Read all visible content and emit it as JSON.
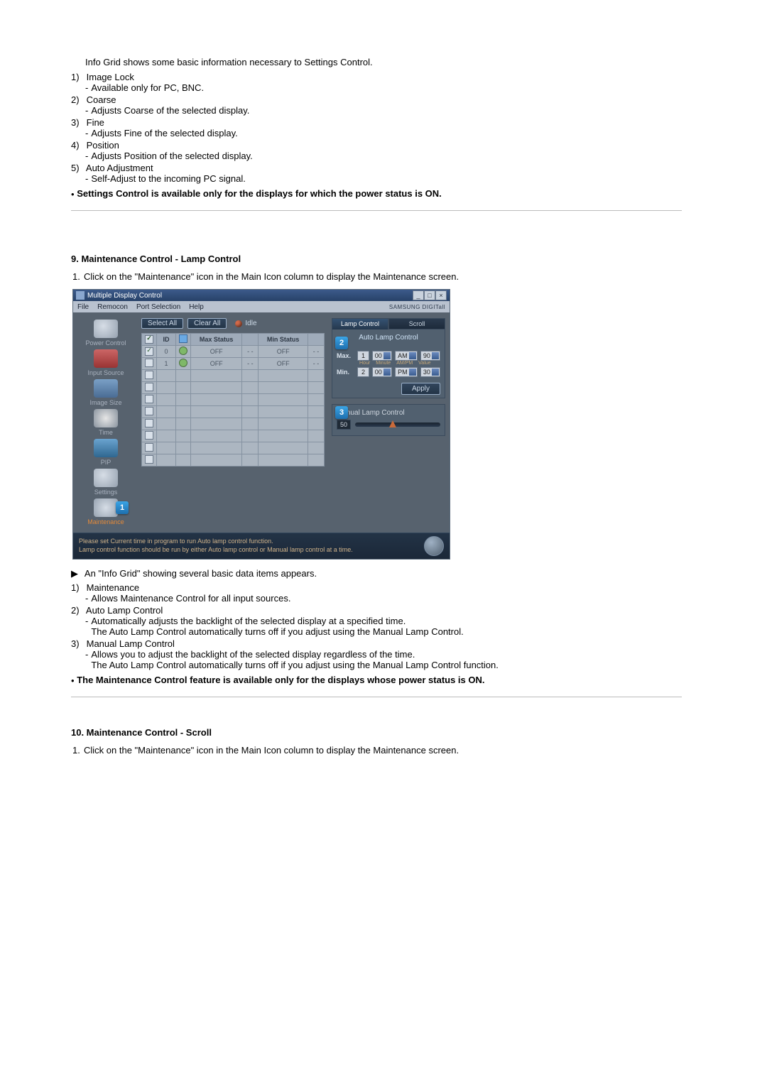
{
  "top": {
    "intro": "Info Grid shows some basic information necessary to Settings Control.",
    "items": [
      {
        "num": "1)",
        "label": "Image Lock",
        "subs": [
          "Available only for PC, BNC."
        ]
      },
      {
        "num": "2)",
        "label": "Coarse",
        "subs": [
          "Adjusts Coarse of the selected display."
        ]
      },
      {
        "num": "3)",
        "label": "Fine",
        "subs": [
          "Adjusts Fine of the selected display."
        ]
      },
      {
        "num": "4)",
        "label": "Position",
        "subs": [
          "Adjusts Position of the selected display."
        ]
      },
      {
        "num": "5)",
        "label": "Auto Adjustment",
        "subs": [
          "Self-Adjust to the incoming PC signal."
        ]
      }
    ],
    "note": "Settings Control is available only for the displays for which the power status is ON."
  },
  "section9": {
    "title": "9. Maintenance Control - Lamp Control",
    "step1": "Click on the \"Maintenance\" icon in the Main Icon column to display the Maintenance screen.",
    "arrow_line": "An \"Info Grid\" showing several basic data items appears.",
    "items": [
      {
        "num": "1)",
        "label": "Maintenance",
        "subs": [
          "Allows Maintenance Control for all input sources."
        ]
      },
      {
        "num": "2)",
        "label": "Auto Lamp Control",
        "subs": [
          "Automatically adjusts the backlight of the selected display at a specified time.",
          "The Auto Lamp Control automatically turns off if you adjust using the Manual Lamp Control."
        ]
      },
      {
        "num": "3)",
        "label": "Manual Lamp Control",
        "subs": [
          "Allows you to adjust the backlight of the selected display regardless of the time.",
          "The Auto Lamp Control automatically turns off if you adjust using the Manual Lamp Control function."
        ]
      }
    ],
    "note": "The Maintenance Control feature is available only for the displays whose power status is ON."
  },
  "section10": {
    "title": "10. Maintenance Control - Scroll",
    "step1": "Click on the \"Maintenance\" icon in the Main Icon column to display the Maintenance screen."
  },
  "app": {
    "title": "Multiple Display Control",
    "menu": {
      "file": "File",
      "remocon": "Remocon",
      "port": "Port Selection",
      "help": "Help"
    },
    "brand": "SAMSUNG DIGITall",
    "sidebar": [
      {
        "label": "Power Control"
      },
      {
        "label": "Input Source"
      },
      {
        "label": "Image Size"
      },
      {
        "label": "Time"
      },
      {
        "label": "PIP"
      },
      {
        "label": "Settings"
      },
      {
        "label": "Maintenance"
      }
    ],
    "toolbar": {
      "select_all": "Select All",
      "clear_all": "Clear All",
      "idle": "Idle"
    },
    "grid": {
      "headers": {
        "chk": "",
        "id": "ID",
        "pwr": "",
        "max": "Max Status",
        "max_s": "",
        "min": "Min Status",
        "min_s": ""
      },
      "rows": [
        {
          "checked": true,
          "id": "0",
          "max": "OFF",
          "maxs": "- -",
          "min": "OFF",
          "mins": "- -"
        },
        {
          "checked": false,
          "id": "1",
          "max": "OFF",
          "maxs": "- -",
          "min": "OFF",
          "mins": "- -"
        }
      ]
    },
    "right": {
      "tab_lamp": "Lamp Control",
      "tab_scroll": "Scroll",
      "auto_title": "Auto Lamp Control",
      "labels": {
        "hour": "Hour",
        "minute": "Minute",
        "ampm": "AM/PM",
        "value": "Value"
      },
      "max": {
        "label": "Max.",
        "hour": "1",
        "minute": "00",
        "ampm": "AM",
        "value": "90"
      },
      "min": {
        "label": "Min.",
        "hour": "2",
        "minute": "00",
        "ampm": "PM",
        "value": "30"
      },
      "apply": "Apply",
      "manual_title": "Manual Lamp Control",
      "slider_value": "50"
    },
    "badges": {
      "one": "1",
      "two": "2",
      "three": "3"
    },
    "footer": {
      "line1": "Please set Current time in program to run Auto lamp control function.",
      "line2": "Lamp control function should be run by either Auto lamp control or Manual lamp control at a time."
    }
  }
}
